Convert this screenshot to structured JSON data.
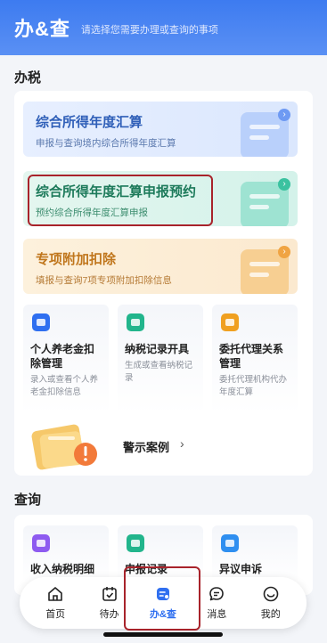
{
  "header": {
    "title": "办&查",
    "subtitle": "请选择您需要办理或查询的事项"
  },
  "sections": {
    "tax_title": "办税",
    "query_title": "查询"
  },
  "banners": [
    {
      "title": "综合所得年度汇算",
      "desc": "申报与查询境内综合所得年度汇算"
    },
    {
      "title": "综合所得年度汇算申报预约",
      "desc": "预约综合所得年度汇算申报"
    },
    {
      "title": "专项附加扣除",
      "desc": "填报与查询7项专项附加扣除信息"
    }
  ],
  "tiles": [
    {
      "title": "个人养老金扣除管理",
      "desc": "录入或查看个人养老金扣除信息",
      "color": "#2f6ff0"
    },
    {
      "title": "纳税记录开具",
      "desc": "生成或查看纳税记录",
      "color": "#22b58c"
    },
    {
      "title": "委托代理关系管理",
      "desc": "委托代理机构代办年度汇算",
      "color": "#f0a020"
    }
  ],
  "warning": {
    "label": "警示案例",
    "chevron": "›"
  },
  "query_tiles": [
    {
      "title": "收入纳税明细",
      "color": "#8e5bf0"
    },
    {
      "title": "申报记录",
      "color": "#22b58c"
    },
    {
      "title": "异议申诉",
      "color": "#2f8ff0"
    }
  ],
  "tabbar": {
    "items": [
      {
        "label": "首页",
        "icon": "home-icon"
      },
      {
        "label": "待办",
        "icon": "calendar-check-icon"
      },
      {
        "label": "办&查",
        "icon": "document-edit-icon",
        "active": true
      },
      {
        "label": "消息",
        "icon": "message-icon"
      },
      {
        "label": "我的",
        "icon": "smile-face-icon"
      }
    ]
  },
  "colors": {
    "brand": "#3d7bf0",
    "highlight": "#a8232b"
  }
}
